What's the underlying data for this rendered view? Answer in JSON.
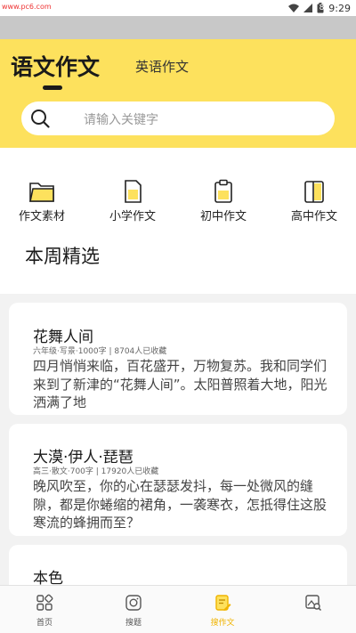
{
  "statusbar": {
    "watermark": "www.pc6.com",
    "time": "9:29",
    "battery": "8"
  },
  "header": {
    "tab_active": "语文作文",
    "tab_other": "英语作文",
    "search_placeholder": "请输入关键字"
  },
  "categories": [
    {
      "label": "作文素材",
      "icon": "folder-icon"
    },
    {
      "label": "小学作文",
      "icon": "document-icon"
    },
    {
      "label": "初中作文",
      "icon": "clipboard-icon"
    },
    {
      "label": "高中作文",
      "icon": "book-icon"
    }
  ],
  "section_title": "本周精选",
  "articles": [
    {
      "title": "花舞人间",
      "meta": "六年级·写景·1000字 | 8704人已收藏",
      "excerpt": "四月悄悄来临，百花盛开，万物复苏。我和同学们来到了新津的“花舞人间”。太阳普照着大地，阳光洒满了地"
    },
    {
      "title": "大漠·伊人·琵琶",
      "meta": "高三·散文·700字 | 17920人已收藏",
      "excerpt": "晚风吹至，你的心在瑟瑟发抖，每一处微风的缝隙，都是你蜷缩的裙角，一袭寒衣，怎抵得住这股寒流的蜂拥而至？"
    },
    {
      "title": "本色"
    }
  ],
  "bottom_nav": [
    {
      "label": "首页",
      "icon": "home-grid-icon"
    },
    {
      "label": "搜题",
      "icon": "camera-icon"
    },
    {
      "label": "搜作文",
      "icon": "edit-note-icon",
      "active": true
    },
    {
      "label": "",
      "icon": "image-search-icon"
    }
  ],
  "colors": {
    "accent": "#fde15d",
    "active_nav": "#f0b400"
  }
}
